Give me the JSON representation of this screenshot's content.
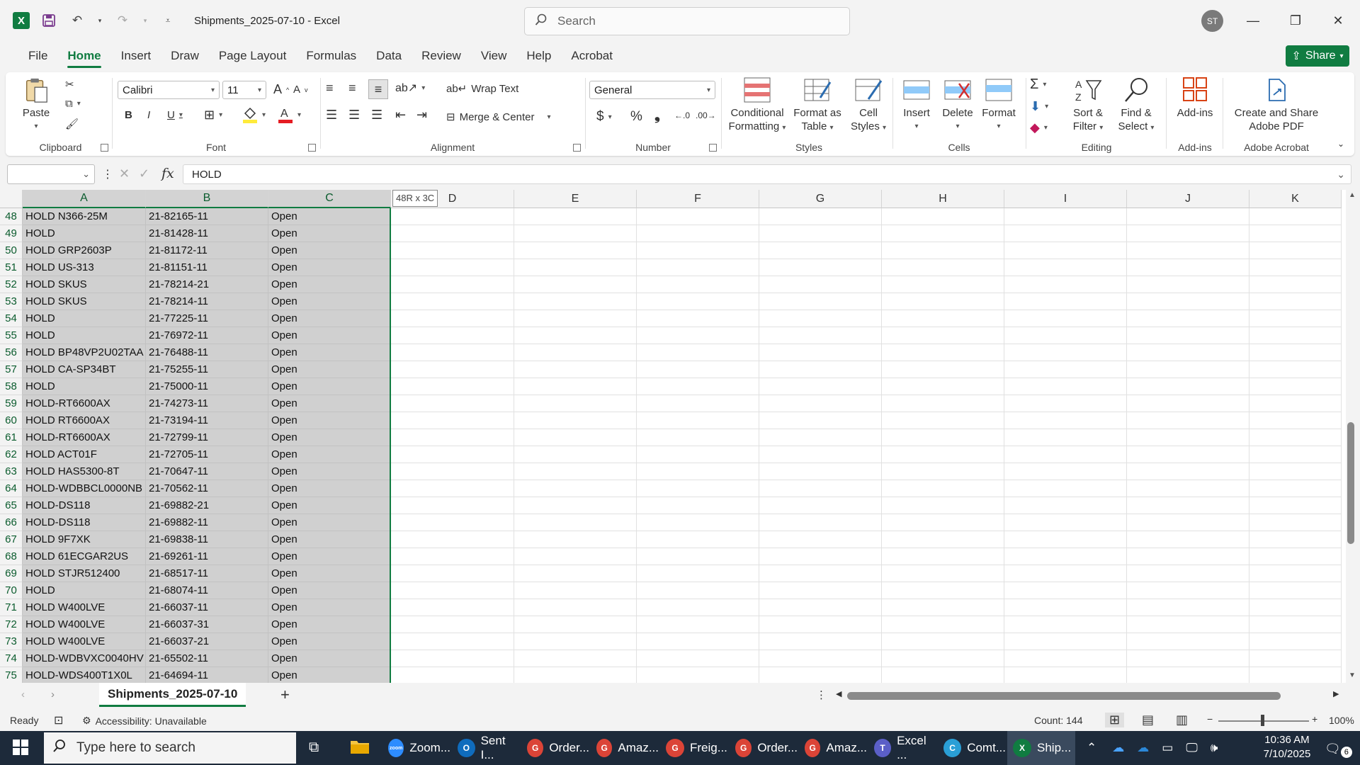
{
  "titlebar": {
    "app_logo": "X",
    "title": "Shipments_2025-07-10  -  Excel",
    "search_placeholder": "Search",
    "avatar_initials": "ST"
  },
  "menu": {
    "tabs": [
      "File",
      "Home",
      "Insert",
      "Draw",
      "Page Layout",
      "Formulas",
      "Data",
      "Review",
      "View",
      "Help",
      "Acrobat"
    ],
    "active": "Home",
    "share_label": "Share"
  },
  "ribbon": {
    "clipboard": {
      "label": "Clipboard",
      "paste": "Paste"
    },
    "font": {
      "label": "Font",
      "family": "Calibri",
      "size": "11"
    },
    "alignment": {
      "label": "Alignment",
      "wrap": "Wrap Text",
      "merge": "Merge & Center"
    },
    "number": {
      "label": "Number",
      "format": "General"
    },
    "styles": {
      "label": "Styles",
      "conditional_1": "Conditional",
      "conditional_2": "Formatting",
      "format_table_1": "Format as",
      "format_table_2": "Table",
      "cell_styles_1": "Cell",
      "cell_styles_2": "Styles"
    },
    "cells": {
      "label": "Cells",
      "insert": "Insert",
      "delete": "Delete",
      "format": "Format"
    },
    "editing": {
      "label": "Editing",
      "sort_1": "Sort &",
      "sort_2": "Filter",
      "find_1": "Find &",
      "find_2": "Select"
    },
    "addins": {
      "label": "Add-ins",
      "button": "Add-ins"
    },
    "acrobat": {
      "label": "Adobe Acrobat",
      "button_1": "Create and Share",
      "button_2": "Adobe PDF"
    }
  },
  "formula_bar": {
    "fx": "fx",
    "value": "HOLD"
  },
  "grid": {
    "columns": [
      "A",
      "B",
      "C",
      "D",
      "E",
      "F",
      "G",
      "H",
      "I",
      "J",
      "K"
    ],
    "selection_tip": "48R x 3C",
    "rows": [
      {
        "n": "48",
        "a": "HOLD N366-25M",
        "b": "21-82165-11",
        "c": "Open"
      },
      {
        "n": "49",
        "a": "HOLD",
        "b": "21-81428-11",
        "c": "Open"
      },
      {
        "n": "50",
        "a": "HOLD GRP2603P",
        "b": "21-81172-11",
        "c": "Open"
      },
      {
        "n": "51",
        "a": "HOLD US-313",
        "b": "21-81151-11",
        "c": "Open"
      },
      {
        "n": "52",
        "a": "HOLD SKUS",
        "b": "21-78214-21",
        "c": "Open"
      },
      {
        "n": "53",
        "a": "HOLD SKUS",
        "b": "21-78214-11",
        "c": "Open"
      },
      {
        "n": "54",
        "a": "HOLD",
        "b": "21-77225-11",
        "c": "Open"
      },
      {
        "n": "55",
        "a": "HOLD",
        "b": "21-76972-11",
        "c": "Open"
      },
      {
        "n": "56",
        "a": "HOLD BP48VP2U02TAA",
        "b": "21-76488-11",
        "c": "Open"
      },
      {
        "n": "57",
        "a": "HOLD CA-SP34BT",
        "b": "21-75255-11",
        "c": "Open"
      },
      {
        "n": "58",
        "a": "HOLD",
        "b": "21-75000-11",
        "c": "Open"
      },
      {
        "n": "59",
        "a": "HOLD-RT6600AX",
        "b": "21-74273-11",
        "c": "Open"
      },
      {
        "n": "60",
        "a": "HOLD RT6600AX",
        "b": "21-73194-11",
        "c": "Open"
      },
      {
        "n": "61",
        "a": "HOLD-RT6600AX",
        "b": "21-72799-11",
        "c": "Open"
      },
      {
        "n": "62",
        "a": "HOLD ACT01F",
        "b": "21-72705-11",
        "c": "Open"
      },
      {
        "n": "63",
        "a": "HOLD HAS5300-8T",
        "b": "21-70647-11",
        "c": "Open"
      },
      {
        "n": "64",
        "a": "HOLD-WDBBCL0000NB",
        "b": "21-70562-11",
        "c": "Open"
      },
      {
        "n": "65",
        "a": "HOLD-DS118",
        "b": "21-69882-21",
        "c": "Open"
      },
      {
        "n": "66",
        "a": "HOLD-DS118",
        "b": "21-69882-11",
        "c": "Open"
      },
      {
        "n": "67",
        "a": "HOLD 9F7XK",
        "b": "21-69838-11",
        "c": "Open"
      },
      {
        "n": "68",
        "a": "HOLD 61ECGAR2US",
        "b": "21-69261-11",
        "c": "Open"
      },
      {
        "n": "69",
        "a": "HOLD STJR512400",
        "b": "21-68517-11",
        "c": "Open"
      },
      {
        "n": "70",
        "a": "HOLD",
        "b": "21-68074-11",
        "c": "Open"
      },
      {
        "n": "71",
        "a": "HOLD W400LVE",
        "b": "21-66037-11",
        "c": "Open"
      },
      {
        "n": "72",
        "a": "HOLD W400LVE",
        "b": "21-66037-31",
        "c": "Open"
      },
      {
        "n": "73",
        "a": "HOLD W400LVE",
        "b": "21-66037-21",
        "c": "Open"
      },
      {
        "n": "74",
        "a": "HOLD-WDBVXC0040HV",
        "b": "21-65502-11",
        "c": "Open"
      },
      {
        "n": "75",
        "a": "HOLD-WDS400T1X0L",
        "b": "21-64694-11",
        "c": "Open"
      }
    ]
  },
  "sheets": {
    "active": "Shipments_2025-07-10",
    "add": "+"
  },
  "status": {
    "ready": "Ready",
    "accessibility": "Accessibility: Unavailable",
    "count": "Count: 144",
    "zoom": "100%"
  },
  "taskbar": {
    "search_placeholder": "Type here to search",
    "apps": [
      {
        "label": "Zoom...",
        "color": "#2d8cff",
        "glyph": "zoom"
      },
      {
        "label": "Sent I...",
        "color": "#0f6cbd",
        "glyph": "O"
      },
      {
        "label": "Order...",
        "color": "#db4437",
        "glyph": "G"
      },
      {
        "label": "Amaz...",
        "color": "#db4437",
        "glyph": "G"
      },
      {
        "label": "Freig...",
        "color": "#db4437",
        "glyph": "G"
      },
      {
        "label": "Order...",
        "color": "#db4437",
        "glyph": "G"
      },
      {
        "label": "Amaz...",
        "color": "#db4437",
        "glyph": "G"
      },
      {
        "label": "Excel ...",
        "color": "#5b5fc7",
        "glyph": "T"
      },
      {
        "label": "Comt...",
        "color": "#2a9fd6",
        "glyph": "C"
      },
      {
        "label": "Ship...",
        "color": "#107c41",
        "glyph": "X"
      }
    ],
    "time": "10:36 AM",
    "date": "7/10/2025",
    "notifications": "6"
  },
  "colors": {
    "accent": "#107c41",
    "selection": "#d0d0d0"
  }
}
